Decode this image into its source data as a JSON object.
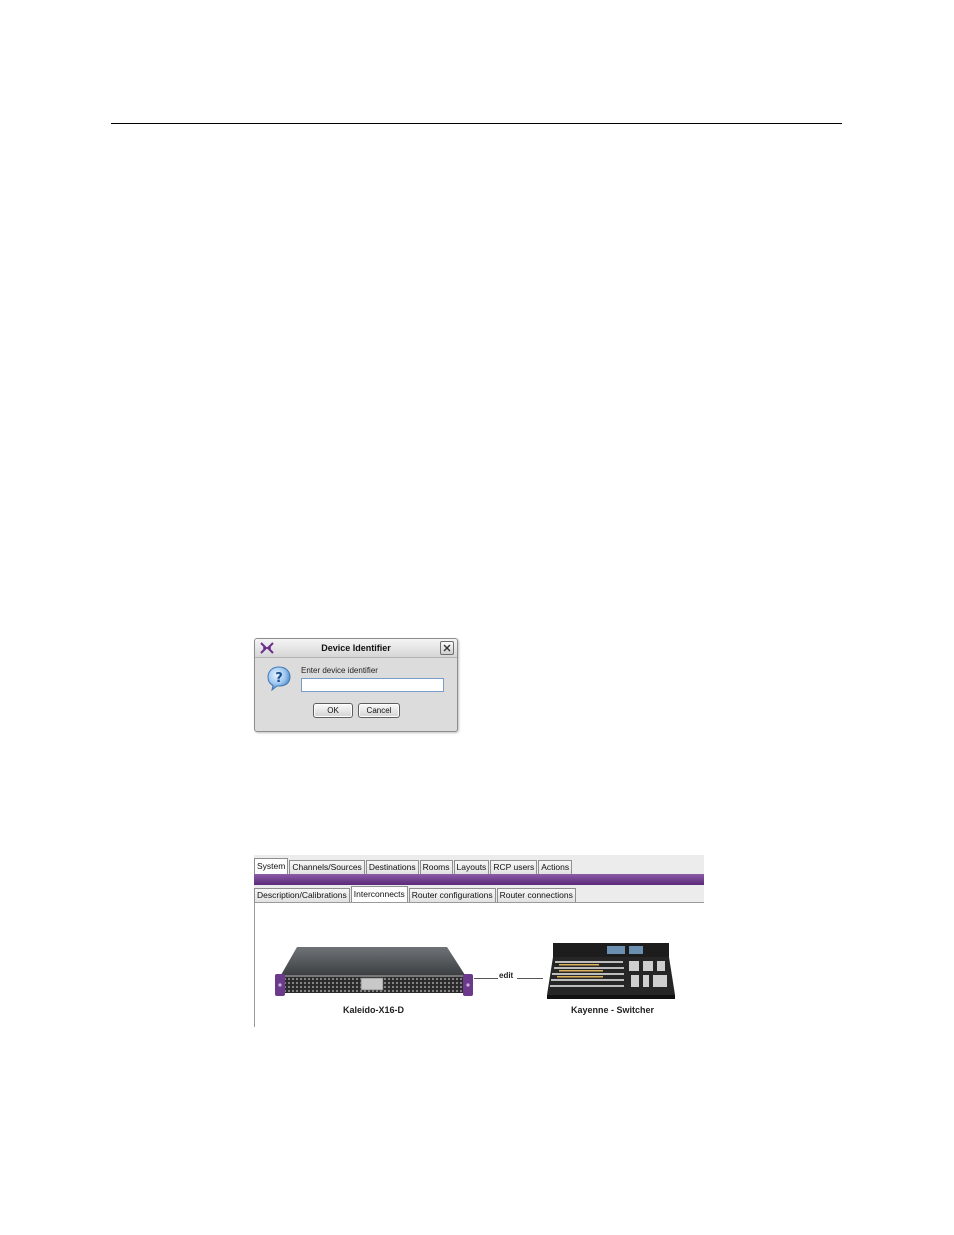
{
  "dialog": {
    "title": "Device Identifier",
    "prompt": "Enter device identifier",
    "input_value": "",
    "ok_label": "OK",
    "cancel_label": "Cancel"
  },
  "panel": {
    "tabs": [
      "System",
      "Channels/Sources",
      "Destinations",
      "Rooms",
      "Layouts",
      "RCP users",
      "Actions"
    ],
    "active_tab": "System",
    "subtabs": [
      "Description/Calibrations",
      "Interconnects",
      "Router configurations",
      "Router connections"
    ],
    "active_subtab": "Interconnects",
    "link_label": "edit",
    "device_left": "Kaleido-X16-D",
    "device_right": "Kayenne - Switcher",
    "colors": {
      "accent": "#6b3a8c",
      "window_bg": "#dcdcdc"
    }
  }
}
